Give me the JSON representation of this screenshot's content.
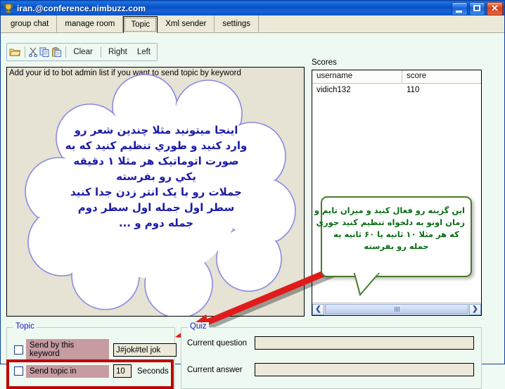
{
  "window": {
    "title": "iran.@conference.nimbuzz.com",
    "icon": "trophy-icon",
    "controls": {
      "minimize": "Minimize",
      "maximize": "Maximize",
      "close": "Close"
    }
  },
  "tabs": [
    {
      "label": "group chat",
      "active": false
    },
    {
      "label": "manage room",
      "active": false
    },
    {
      "label": "Topic",
      "active": true
    },
    {
      "label": "Xml sender",
      "active": false
    },
    {
      "label": "settings",
      "active": false
    }
  ],
  "toolbar": {
    "open_icon": "open-folder-icon",
    "cut_icon": "scissors-icon",
    "copy_icon": "copy-icon",
    "paste_icon": "paste-icon",
    "clear_label": "Clear",
    "right_label": "Right",
    "left_label": "Left"
  },
  "editor": {
    "hint": "Add your id to bot admin list if you want to send topic by keyword",
    "cloud_lines": [
      "اینجا میتونید مثلا چندین شعر رو",
      "وارد کنید و طوري تنظیم کنید که به",
      "صورت اتوماتیک هر مثلا ۱ دقیقه",
      "یکي رو بفرسته",
      "جملات رو با یک انتر زدن جدا کنید",
      "سطر اول جمله اول سطر دوم",
      "جمله دوم و ..."
    ],
    "cloud_outline_color": "#8a8ae0"
  },
  "scores": {
    "label": "Scores",
    "columns": [
      "username",
      "score"
    ],
    "rows": [
      {
        "username": "vidich132",
        "score": "110"
      }
    ],
    "scroll_left_icon": "chevron-left-icon",
    "scroll_right_icon": "chevron-right-icon"
  },
  "callout": {
    "lines": [
      "این گزینه رو فعال کنید و میزان تایم و",
      "زمان اونو به دلخواه تنظیم کنید جوري",
      "که هر مثلا ۱۰ ثانیه یا ۶۰ ثانیه یه",
      "جمله رو بفرسته"
    ],
    "border_color": "#4a7a2a",
    "text_color": "#0a6b14"
  },
  "annotation": {
    "arrow_color": "#e01b1b",
    "highlight_color": "#c00000"
  },
  "topic_group": {
    "title": "Topic",
    "send_by_keyword_label": "Send by this keyword",
    "keyword_value": "J#jok#tel jok",
    "keyword_placeholder": "",
    "send_topic_in_label": "Send topic in",
    "seconds_value": "10",
    "seconds_placeholder": "",
    "seconds_unit": "Seconds"
  },
  "quiz_group": {
    "title": "Quiz",
    "current_question_label": "Current question",
    "current_question_value": "",
    "current_question_placeholder": "",
    "current_answer_label": "Current answer",
    "current_answer_value": "",
    "current_answer_placeholder": ""
  }
}
